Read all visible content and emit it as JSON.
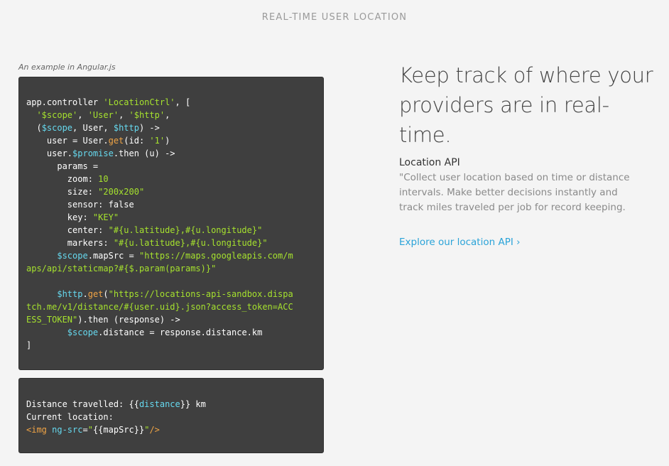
{
  "section_title": "REAL-TIME USER LOCATION",
  "code_caption": "An example in Angular.js",
  "code_controller": [
    [
      [
        "t",
        "app.controller "
      ],
      [
        "s",
        "'LocationCtrl'"
      ],
      [
        "t",
        ", ["
      ]
    ],
    [
      [
        "t",
        "  "
      ],
      [
        "s",
        "'$scope'"
      ],
      [
        "t",
        ", "
      ],
      [
        "s",
        "'User'"
      ],
      [
        "t",
        ", "
      ],
      [
        "s",
        "'$http'"
      ],
      [
        "t",
        ","
      ]
    ],
    [
      [
        "t",
        "  ("
      ],
      [
        "v",
        "$scope"
      ],
      [
        "t",
        ", User, "
      ],
      [
        "v",
        "$http"
      ],
      [
        "t",
        ") ->"
      ]
    ],
    [
      [
        "t",
        "    user = User."
      ],
      [
        "f",
        "get"
      ],
      [
        "t",
        "(id: "
      ],
      [
        "s",
        "'1'"
      ],
      [
        "t",
        ")"
      ]
    ],
    [
      [
        "t",
        "    user."
      ],
      [
        "v",
        "$promise"
      ],
      [
        "t",
        ".then (u) ->"
      ]
    ],
    [
      [
        "t",
        "      params ="
      ]
    ],
    [
      [
        "t",
        "        zoom: "
      ],
      [
        "n",
        "10"
      ]
    ],
    [
      [
        "t",
        "        size: "
      ],
      [
        "s",
        "\"200x200\""
      ]
    ],
    [
      [
        "t",
        "        sensor: false"
      ]
    ],
    [
      [
        "t",
        "        key: "
      ],
      [
        "s",
        "\"KEY\""
      ]
    ],
    [
      [
        "t",
        "        center: "
      ],
      [
        "s",
        "\"#{u.latitude},#{u.longitude}\""
      ]
    ],
    [
      [
        "t",
        "        markers: "
      ],
      [
        "s",
        "\"#{u.latitude},#{u.longitude}\""
      ]
    ],
    [
      [
        "t",
        "      "
      ],
      [
        "v",
        "$scope"
      ],
      [
        "t",
        ".mapSrc = "
      ],
      [
        "s",
        "\"https://maps.googleapis.com/m"
      ]
    ],
    [
      [
        "s",
        "aps/api/staticmap?#{$.param(params)}\""
      ]
    ],
    [
      [
        "t",
        ""
      ]
    ],
    [
      [
        "t",
        "      "
      ],
      [
        "v",
        "$http"
      ],
      [
        "t",
        "."
      ],
      [
        "f",
        "get"
      ],
      [
        "t",
        "("
      ],
      [
        "s",
        "\"https://locations-api-sandbox.dispa"
      ]
    ],
    [
      [
        "s",
        "tch.me/v1/distance/#{user.uid}.json?access_token=ACC"
      ]
    ],
    [
      [
        "s",
        "ESS_TOKEN\""
      ],
      [
        "t",
        ").then (response) ->"
      ]
    ],
    [
      [
        "t",
        "        "
      ],
      [
        "v",
        "$scope"
      ],
      [
        "t",
        ".distance = response.distance.km"
      ]
    ],
    [
      [
        "t",
        "]"
      ]
    ]
  ],
  "code_template": [
    [
      [
        "t",
        "Distance travelled: {{"
      ],
      [
        "v",
        "distance"
      ],
      [
        "t",
        "}} km"
      ]
    ],
    [
      [
        "t",
        "Current location:"
      ]
    ],
    [
      [
        "f",
        "<img "
      ],
      [
        "a",
        "ng-src"
      ],
      [
        "t",
        "="
      ],
      [
        "s",
        "\""
      ],
      [
        "t",
        "{{mapSrc}}"
      ],
      [
        "s",
        "\""
      ],
      [
        "f",
        "/>"
      ]
    ]
  ],
  "headline": "Keep track of where your providers are in real-time.",
  "api": {
    "title": "Location API",
    "description": "\"Collect user location based on time or distance intervals. Make better decisions instantly and track miles traveled per job for record keeping.",
    "link_label": "Explore our location API ›"
  }
}
